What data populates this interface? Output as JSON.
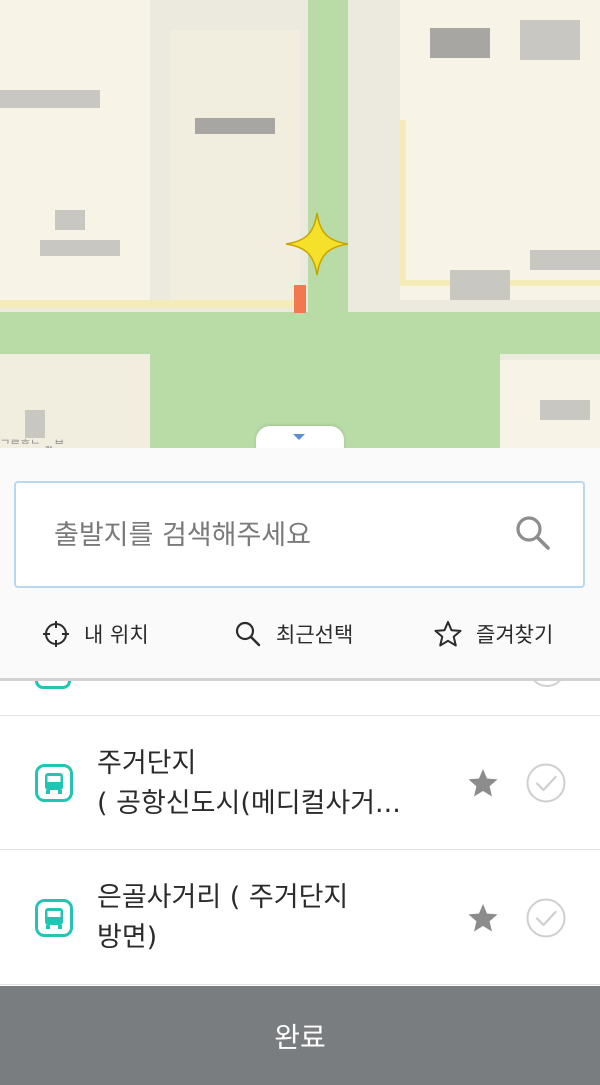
{
  "map": {
    "caption": "ᄀᄅᄒᄂ ᆳᄇ"
  },
  "search": {
    "placeholder": "출발지를 검색해주세요",
    "value": ""
  },
  "quick_actions": [
    {
      "label": "내 위치",
      "icon": "crosshair-icon"
    },
    {
      "label": "최근선택",
      "icon": "search-icon"
    },
    {
      "label": "즐겨찾기",
      "icon": "star-outline-icon"
    }
  ],
  "results": [
    {
      "line1": "주거단지",
      "line2": "( 공항신도시(메디컬사거...",
      "type_icon": "bus-icon"
    },
    {
      "line1": "은골사거리 ( 주거단지",
      "line2": "방면)",
      "type_icon": "bus-icon"
    }
  ],
  "footer": {
    "done_label": "완료"
  },
  "colors": {
    "accent_teal": "#22c5b3",
    "search_border": "#b9d7ef",
    "footer_bg": "#7a7d80",
    "map_road": "#b9dba6"
  }
}
